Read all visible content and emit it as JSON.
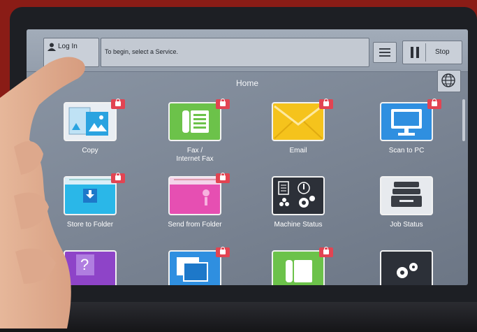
{
  "header": {
    "login_label": "Log In",
    "message": "To begin, select a Service.",
    "stop_label": "Stop"
  },
  "home": {
    "title": "Home"
  },
  "services": [
    {
      "label": "Copy",
      "icon": "copy-icon",
      "locked": true
    },
    {
      "label": "Fax /\nInternet Fax",
      "icon": "fax-icon",
      "locked": true
    },
    {
      "label": "Email",
      "icon": "email-icon",
      "locked": true
    },
    {
      "label": "Scan to PC",
      "icon": "scan-to-pc-icon",
      "locked": true
    },
    {
      "label": "Store to Folder",
      "icon": "store-to-folder-icon",
      "locked": true
    },
    {
      "label": "Send from Folder",
      "icon": "send-from-folder-icon",
      "locked": true
    },
    {
      "label": "Machine Status",
      "icon": "machine-status-icon",
      "locked": false
    },
    {
      "label": "Job Status",
      "icon": "job-status-icon",
      "locked": false
    },
    {
      "label": "",
      "icon": "help-icon",
      "locked": false
    },
    {
      "label": "",
      "icon": "device-app-icon",
      "locked": true
    },
    {
      "label": "",
      "icon": "phone-app-icon",
      "locked": true
    },
    {
      "label": "",
      "icon": "settings-icon",
      "locked": false
    }
  ],
  "colors": {
    "lock": "#e24452",
    "fax": "#6cc24a",
    "email": "#f5c31c",
    "scan": "#2f8fe0",
    "folder_blue": "#2ab7e8",
    "folder_pink": "#e64fb2"
  }
}
